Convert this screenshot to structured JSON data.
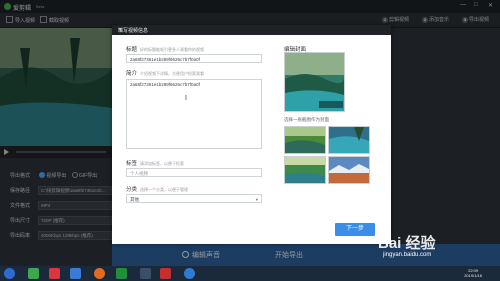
{
  "app": {
    "title": "爱剪辑",
    "version": "Beta",
    "ctrls": [
      "—",
      "□",
      "✕"
    ]
  },
  "toolbar": {
    "tools": [
      "导入视频",
      "截取视频"
    ],
    "steps": [
      "1",
      "2",
      "3"
    ],
    "step_labels": [
      "剪辑视频",
      "添加音乐",
      "导出视频"
    ]
  },
  "left": {
    "rows": [
      {
        "label": "导出格式",
        "value": ""
      },
      {
        "label": "保存路径",
        "value": "C:\\快剪辑视频\\2a68f27361e1b..."
      },
      {
        "label": "文件格式",
        "value": "MP4"
      },
      {
        "label": "导出尺寸",
        "value": "720P (推荐)"
      },
      {
        "label": "导出码率",
        "value": "4000Kbps 128kbps (推荐)"
      }
    ],
    "radio_on": "视频导出",
    "radio_off": "GIF导出"
  },
  "bottom": {
    "left": "编辑声音",
    "right": "开始导出"
  },
  "dialog": {
    "title": "填写视频信息",
    "close": "✕",
    "title_label": "标题",
    "title_hint": "好的标题能吸引更多人观看你的视频",
    "title_value": "2a68f27361e1b289f6626c7b7f0a0f",
    "intro_label": "简介",
    "intro_hint": "介绍视频下详情，方便用户检索观看",
    "intro_value": "2a68f27361e1b289f6626c7b7f0a0f",
    "tag_label": "标签",
    "tag_hint": "请添加标签，以便于检索",
    "tag_placeholder": "个人视频",
    "category_label": "分类",
    "category_hint": "选择一个分类，以便于管理",
    "category_value": "其他",
    "cover_label": "编辑封面",
    "choose_label": "选择一张截图作为封面",
    "next": "下一步"
  },
  "taskbar": {
    "time": "22:09",
    "date": "2019/1/16"
  },
  "watermark": {
    "brand": "Bai 经验",
    "site": "jingyan.baidu.com"
  }
}
